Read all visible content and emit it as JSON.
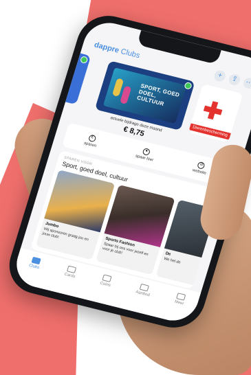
{
  "app": {
    "brand": "dappre",
    "section": "Clubs"
  },
  "header": {
    "icons": [
      "add-icon",
      "share-icon",
      "more-icon"
    ],
    "add_glyph": "+",
    "share_glyph": "⇪",
    "more_glyph": "⋯"
  },
  "carousel": {
    "left_card_label": "ish",
    "center_card_poster": "SPORT, GOED DOEL, CULTUUR",
    "right_card_tag": "Dierenbescherming",
    "caption": "actuele bijdrage deze maand",
    "amount": "€ 8,75"
  },
  "actions": [
    {
      "label": "sparen",
      "icon": "euro-icon",
      "glyph": "€"
    },
    {
      "label": "spaar hier",
      "icon": "location-pin-icon",
      "glyph": "●"
    },
    {
      "label": "website",
      "icon": "compass-icon",
      "glyph": "⊘"
    }
  ],
  "savings": {
    "kicker": "SPAREN VOOR",
    "title": "Sport, goed doel, cultuur",
    "toggle_on": true
  },
  "offers": [
    {
      "name": "Jumbo",
      "desc": "Wij sponsoren graag jou en jouw club!"
    },
    {
      "name": "Sports Fashion",
      "desc": "Spaar bij ons voor jezelf en voor je club!"
    },
    {
      "name": "De",
      "desc": "We hel de"
    }
  ],
  "tabs": [
    {
      "label": "Clubs",
      "icon": "clubs-icon",
      "active": true
    },
    {
      "label": "Cards",
      "icon": "card-icon",
      "active": false
    },
    {
      "label": "Coins",
      "icon": "coins-icon",
      "active": false
    },
    {
      "label": "Aanbod",
      "icon": "offer-icon",
      "active": false
    },
    {
      "label": "Meer",
      "icon": "more-dots-icon",
      "active": false
    }
  ],
  "colors": {
    "coral": "#ef6f6c",
    "accent": "#4a8fe0",
    "toggle": "#3fc85a",
    "red_cross": "#e4322f"
  }
}
